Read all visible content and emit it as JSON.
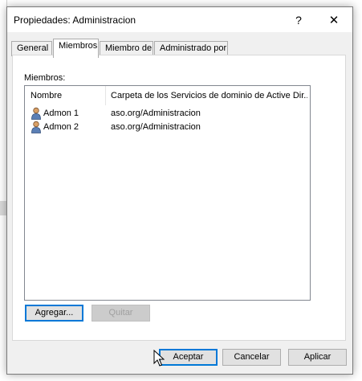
{
  "dialog": {
    "title": "Propiedades: Administracion",
    "help_glyph": "?",
    "close_glyph": "✕"
  },
  "tabs": [
    {
      "label": "General"
    },
    {
      "label": "Miembros"
    },
    {
      "label": "Miembro de"
    },
    {
      "label": "Administrado por"
    }
  ],
  "members": {
    "label": "Miembros:",
    "columns": [
      "Nombre",
      "Carpeta de los Servicios de dominio de Active Dir..."
    ],
    "rows": [
      {
        "name": "Admon 1",
        "folder": "aso.org/Administracion",
        "icon": "user-icon"
      },
      {
        "name": "Admon 2",
        "folder": "aso.org/Administracion",
        "icon": "user-icon"
      }
    ],
    "add_label": "Agregar...",
    "remove_label": "Quitar"
  },
  "footer": {
    "accept_label": "Aceptar",
    "cancel_label": "Cancelar",
    "apply_label": "Aplicar"
  },
  "colors": {
    "focus": "#0078d7",
    "dialog_bg": "#f0f0f0"
  }
}
